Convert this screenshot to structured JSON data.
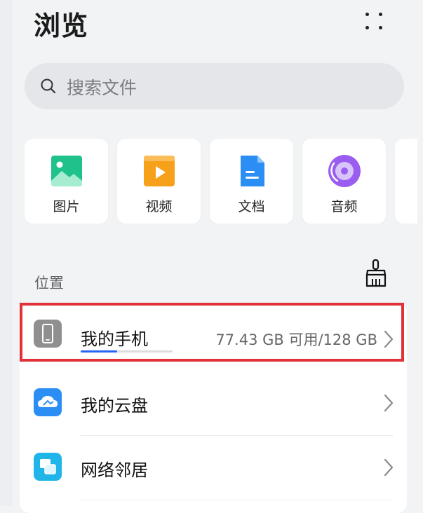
{
  "header": {
    "title": "浏览",
    "more_icon": "more-dots-icon"
  },
  "search": {
    "placeholder": "搜索文件",
    "icon": "search-icon"
  },
  "categories": [
    {
      "label": "图片",
      "icon": "image-icon",
      "color": "#1fc28a"
    },
    {
      "label": "视频",
      "icon": "video-icon",
      "color": "#f6a019"
    },
    {
      "label": "文档",
      "icon": "document-icon",
      "color": "#2a8ef5"
    },
    {
      "label": "音频",
      "icon": "audio-icon",
      "color": "#9a5cf0"
    }
  ],
  "locations": {
    "section_label": "位置",
    "clean_icon": "broom-icon",
    "items": [
      {
        "name": "我的手机",
        "icon": "phone-icon",
        "storage": "77.43 GB 可用/128 GB",
        "used_fraction": 0.3951,
        "highlighted": true
      },
      {
        "name": "我的云盘",
        "icon": "cloud-icon",
        "color": "#2a8ef5"
      },
      {
        "name": "网络邻居",
        "icon": "network-icon",
        "color": "#1fb5e8"
      }
    ]
  },
  "colors": {
    "accent": "#2565f6",
    "highlight": "#e1323a",
    "background": "#f1f3f5"
  }
}
